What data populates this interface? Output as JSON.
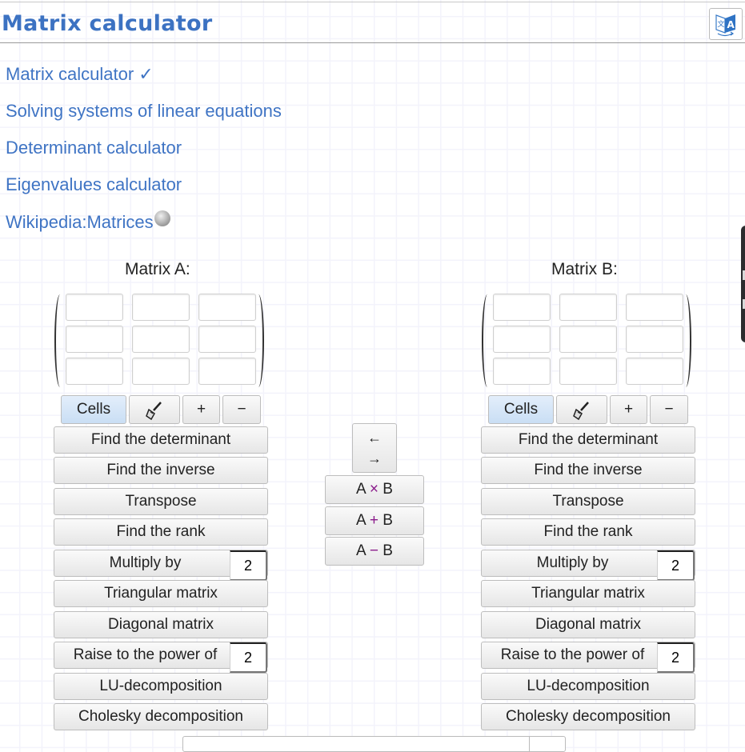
{
  "header": {
    "title": "Matrix calculator",
    "translate_icon": "translate-icon"
  },
  "nav": {
    "links": [
      {
        "label": "Matrix calculator ✓"
      },
      {
        "label": "Solving systems of linear equations"
      },
      {
        "label": "Determinant calculator"
      },
      {
        "label": "Eigenvalues calculator"
      },
      {
        "label": "Wikipedia:Matrices",
        "icon": "wikipedia-globe-icon"
      }
    ]
  },
  "matrixA": {
    "label": "Matrix A:",
    "rows": 3,
    "cols": 3,
    "cells": [
      [
        "",
        "",
        ""
      ],
      [
        "",
        "",
        ""
      ],
      [
        "",
        "",
        ""
      ]
    ],
    "controls": {
      "cells": "Cells",
      "brush_icon": "brush-icon",
      "plus": "+",
      "minus": "−"
    },
    "operations": {
      "determinant": "Find the determinant",
      "inverse": "Find the inverse",
      "transpose": "Transpose",
      "rank": "Find the rank",
      "multiply": "Multiply by",
      "multiply_value": "2",
      "triangular": "Triangular matrix",
      "diagonal": "Diagonal matrix",
      "power": "Raise to the power of",
      "power_value": "2",
      "lu": "LU-decomposition",
      "cholesky": "Cholesky decomposition"
    }
  },
  "matrixB": {
    "label": "Matrix B:",
    "rows": 3,
    "cols": 3,
    "cells": [
      [
        "",
        "",
        ""
      ],
      [
        "",
        "",
        ""
      ],
      [
        "",
        "",
        ""
      ]
    ],
    "controls": {
      "cells": "Cells",
      "brush_icon": "brush-icon",
      "plus": "+",
      "minus": "−"
    },
    "operations": {
      "determinant": "Find the determinant",
      "inverse": "Find the inverse",
      "transpose": "Transpose",
      "rank": "Find the rank",
      "multiply": "Multiply by",
      "multiply_value": "2",
      "triangular": "Triangular matrix",
      "diagonal": "Diagonal matrix",
      "power": "Raise to the power of",
      "power_value": "2",
      "lu": "LU-decomposition",
      "cholesky": "Cholesky decomposition"
    }
  },
  "middle": {
    "swap_left": "←",
    "swap_right": "→",
    "multiply": {
      "a": "A",
      "op": "×",
      "b": "B"
    },
    "add": {
      "a": "A",
      "op": "+",
      "b": "B"
    },
    "subtract": {
      "a": "A",
      "op": "−",
      "b": "B"
    }
  },
  "colors": {
    "title": "#3c72c2",
    "link": "#3f74c4",
    "operator": "#8a1a8a",
    "cells_active": "#c9def4"
  }
}
